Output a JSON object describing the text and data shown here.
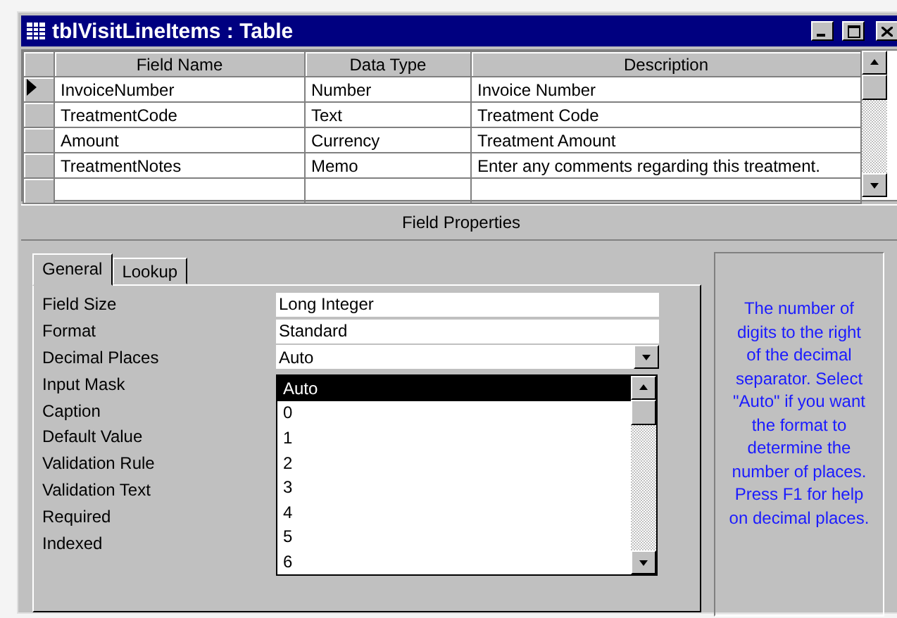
{
  "window": {
    "title": "tblVisitLineItems : Table"
  },
  "grid": {
    "columns": [
      "Field Name",
      "Data Type",
      "Description"
    ],
    "rows": [
      {
        "field_name": "InvoiceNumber",
        "data_type": "Number",
        "description": "Invoice Number",
        "current": true
      },
      {
        "field_name": "TreatmentCode",
        "data_type": "Text",
        "description": "Treatment Code",
        "current": false
      },
      {
        "field_name": "Amount",
        "data_type": "Currency",
        "description": "Treatment Amount",
        "current": false
      },
      {
        "field_name": "TreatmentNotes",
        "data_type": "Memo",
        "description": "Enter any comments regarding this treatment.",
        "current": false
      }
    ]
  },
  "field_properties": {
    "title": "Field Properties",
    "tabs": [
      {
        "label": "General",
        "selected": true
      },
      {
        "label": "Lookup",
        "selected": false
      }
    ],
    "properties": [
      {
        "label": "Field Size",
        "kind": "text",
        "value": "Long Integer"
      },
      {
        "label": "Format",
        "kind": "text",
        "value": "Standard"
      },
      {
        "label": "Decimal Places",
        "kind": "combo",
        "value": "Auto"
      },
      {
        "label": "Input Mask",
        "kind": "none"
      },
      {
        "label": "Caption",
        "kind": "none"
      },
      {
        "label": "Default Value",
        "kind": "none"
      },
      {
        "label": "Validation Rule",
        "kind": "none"
      },
      {
        "label": "Validation Text",
        "kind": "none"
      },
      {
        "label": "Required",
        "kind": "none"
      },
      {
        "label": "Indexed",
        "kind": "none"
      }
    ],
    "dropdown": {
      "items": [
        {
          "label": "Auto",
          "selected": true
        },
        {
          "label": "0",
          "selected": false
        },
        {
          "label": "1",
          "selected": false
        },
        {
          "label": "2",
          "selected": false
        },
        {
          "label": "3",
          "selected": false
        },
        {
          "label": "4",
          "selected": false
        },
        {
          "label": "5",
          "selected": false
        },
        {
          "label": "6",
          "selected": false
        }
      ]
    },
    "help_text": "The number of digits to the right of the decimal separator. Select \"Auto\" if you want the format to determine the number of places. Press F1 for help on decimal places."
  }
}
